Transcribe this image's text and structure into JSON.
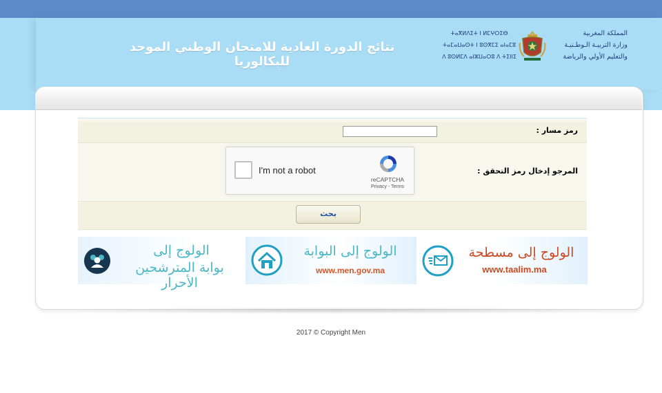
{
  "header": {
    "title": "نتائج الدورة العادية للامتحان الوطني الموحد للبكالوريا",
    "logo_ar_lines": [
      "المملكة المغربية",
      "وزارة التربيـة الـوطـنيـة",
      "والتعليم الأولي والرياضة"
    ],
    "logo_tif_lines": [
      "ⵜⴰⴳⵍⴷⵉⵜ ⵏ ⵍⵎⵖⵔⵉⴱ",
      "ⵜⴰⵎⴰⵡⴰⵙⵜ ⵏ ⵓⵙⴳⵎⵉ ⴰⵏⴰⵎⵓ",
      "ⴷ ⵓⵙⵍⵎⴷ ⴰⵏⵣⵡⴰⵔⵓ ⴷ ⵜⵉⵏⵏⵉ"
    ]
  },
  "form": {
    "massar_label": "رمز مسار :",
    "captcha_label": "المرجو إدخال رمز التحقق :",
    "search_button": "بحث"
  },
  "recaptcha": {
    "checkbox_label": "I'm not a robot",
    "brand": "reCAPTCHA",
    "links": "Privacy - Terms"
  },
  "banners": [
    {
      "line1": "الولوج إلى",
      "line2": "بوابة المترشحين الأحرار",
      "icon": "users-icon"
    },
    {
      "line1": "الولوج إلى البوابة",
      "line2": "www.men.gov.ma",
      "icon": "home-icon"
    },
    {
      "line1": "الولوج إلى مسطحة",
      "line2": "www.taalim.ma",
      "icon": "mail-icon"
    }
  ],
  "footer": {
    "copyright": "2017 © Copyright Men"
  },
  "colors": {
    "topbar": "#5b8ac8",
    "header": "#a9dcf5",
    "banner_text": "#4bb8c8",
    "url_text": "#d6562b"
  }
}
